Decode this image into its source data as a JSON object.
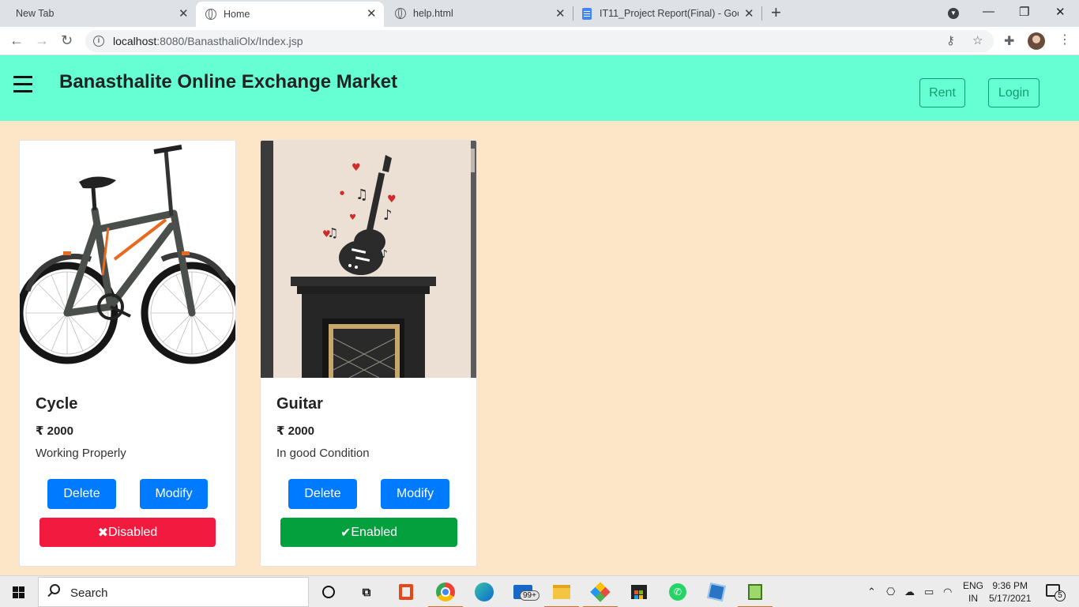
{
  "browser": {
    "tabs": [
      {
        "title": "New Tab",
        "active": false
      },
      {
        "title": "Home",
        "active": true
      },
      {
        "title": "help.html",
        "active": false
      },
      {
        "title": "IT11_Project Report(Final) - Goog",
        "active": false
      }
    ],
    "url_host": "localhost",
    "url_path": ":8080/BanasthaliOlx/Index.jsp"
  },
  "site": {
    "title": "Banasthalite Online Exchange Market",
    "nav": {
      "rent": "Rent",
      "login": "Login"
    }
  },
  "products": [
    {
      "name": "Cycle",
      "price": "₹ 2000",
      "description": "Working Properly",
      "delete_label": "Delete",
      "modify_label": "Modify",
      "status_label": "Disabled",
      "status_icon": "✖"
    },
    {
      "name": "Guitar",
      "price": "₹ 2000",
      "description": "In good Condition",
      "delete_label": "Delete",
      "modify_label": "Modify",
      "status_label": "Enabled",
      "status_icon": "✔"
    }
  ],
  "taskbar": {
    "search_text": "Search",
    "mail_badge": "99+",
    "lang_top": "ENG",
    "lang_bottom": "IN",
    "time": "9:36 PM",
    "date": "5/17/2021",
    "notification_count": "5"
  },
  "colors": {
    "navbar": "#66ffd4",
    "page_bg": "#fde5c8",
    "primary": "#007bff",
    "danger": "#f21b3f",
    "success": "#04a03e"
  }
}
